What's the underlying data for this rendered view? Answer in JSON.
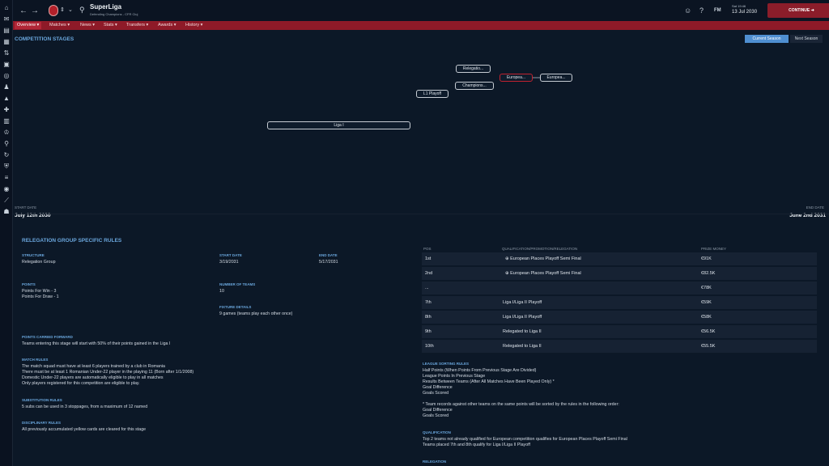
{
  "header": {
    "title": "SuperLiga",
    "subtitle": "Defending Champions - CFR Cluj",
    "date_line1": "Sat 19:46",
    "date_line2": "13 Jul 2030",
    "continue_label": "CONTINUE",
    "fm_label": "FM"
  },
  "tabs": [
    {
      "label": "Overview ▾"
    },
    {
      "label": "Matches ▾"
    },
    {
      "label": "News ▾"
    },
    {
      "label": "Stats ▾"
    },
    {
      "label": "Transfers ▾"
    },
    {
      "label": "Awards ▾"
    },
    {
      "label": "History ▾"
    }
  ],
  "stages": {
    "heading": "COMPETITION STAGES",
    "current_season": "Current Season",
    "next_season": "Next Season",
    "nodes": {
      "relegation": "Relegatio...",
      "champions": "Champions...",
      "europa_sel": "Europea...",
      "europa2": "Europea...",
      "l1playoff": "L1 Playoff",
      "liga1": "Liga I"
    },
    "start_label": "START DATE",
    "start_date": "July 12th 2030",
    "end_label": "END DATE",
    "end_date": "June 2nd 2031"
  },
  "rules": {
    "heading": "RELEGATION GROUP SPECIFIC RULES",
    "structure_label": "STRUCTURE",
    "structure_value": "Relegation Group",
    "start_label": "START DATE",
    "start_value": "3/19/2031",
    "end_label": "END DATE",
    "end_value": "5/17/2031",
    "points_label": "POINTS",
    "points_win": "Points For Win - 3",
    "points_draw": "Points For Draw - 1",
    "teams_label": "NUMBER OF TEAMS",
    "teams_value": "10",
    "fixture_label": "FIXTURE DETAILS",
    "fixture_value": "9 games (teams play each other once)",
    "carried_label": "POINTS CARRIED FORWARD",
    "carried_value": "Teams entering this stage will start with 50% of their points gained in the Liga I",
    "match_label": "MATCH RULES",
    "match_lines": [
      "The match squad must have at least 6 players trained by a club in Romania",
      "There must be at least 1 Romanian Under-22 player in the playing 11 (Born after 1/1/2008)",
      "Domestic Under-22 players are automatically eligible to play in all matches",
      "Only players registered for this competition are eligible to play."
    ],
    "subs_label": "SUBSTITUTION RULES",
    "subs_value": "5 subs can be used in 3 stoppages, from a maximum of 12 named",
    "disc_label": "DISCIPLINARY RULES",
    "disc_value": "All previously accumulated yellow cards are cleared for this stage"
  },
  "table": {
    "col_pos": "POS",
    "col_qual": "QUALIFICATION/PROMOTION/RELEGATION",
    "col_prize": "PRIZE MONEY",
    "rows": [
      {
        "pos": "1st",
        "qual": "⊕ European Places Playoff Semi Final",
        "prize": "€91K"
      },
      {
        "pos": "2nd",
        "qual": "⊕ European Places Playoff Semi Final",
        "prize": "€82.5K"
      },
      {
        "pos": "...",
        "qual": "",
        "prize": "€78K"
      },
      {
        "pos": "7th",
        "qual": "Liga I/Liga II Playoff",
        "prize": "€59K"
      },
      {
        "pos": "8th",
        "qual": "Liga I/Liga II Playoff",
        "prize": "€58K"
      },
      {
        "pos": "9th",
        "qual": "Relegated to Liga II",
        "prize": "€56.5K"
      },
      {
        "pos": "10th",
        "qual": "Relegated to Liga II",
        "prize": "€55.5K"
      }
    ]
  },
  "sorting": {
    "label": "LEAGUE SORTING RULES",
    "lines": [
      "Half Points (When Points From Previous Stage Are Divided)",
      "League Points In Previous Stage",
      "Results Between Teams (After All Matches Have Been Played Only) *",
      "Goal Difference",
      "Goals Scored"
    ],
    "note": "* Team records against other teams on the same points will be sorted by the rules in the following order:",
    "note_lines": [
      "Goal Difference",
      "Goals Scored"
    ]
  },
  "qualification": {
    "label": "QUALIFICATION",
    "lines": [
      "Top 2 teams not already qualified for European competition qualifies for European Places Playoff Semi Final",
      "Teams placed 7th and 8th qualify for Liga I/Liga II Playoff"
    ]
  },
  "relegation": {
    "label": "RELEGATION"
  }
}
